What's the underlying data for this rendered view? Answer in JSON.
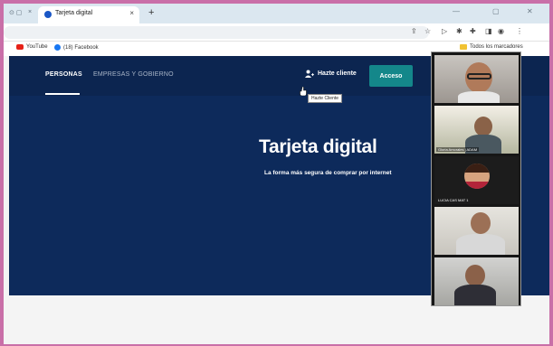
{
  "browser": {
    "tab_title": "Tarjeta digital",
    "tab_close": "×",
    "new_tab": "+",
    "bookmarks": [
      {
        "label": "YouTube"
      },
      {
        "label": "(18) Facebook"
      }
    ],
    "bookmarks_folder": "Todos los marcadores"
  },
  "nav": {
    "personas": "PERSONAS",
    "empresas": "EMPRESAS Y GOBIERNO",
    "hazte_cliente": "Hazte cliente",
    "acceso": "Acceso"
  },
  "hero": {
    "title": "Tarjeta digital",
    "subtitle": "La forma más segura de comprar por internet"
  },
  "tooltip": "Hazte Cliente",
  "video_call": {
    "participants": [
      {
        "label": ""
      },
      {
        "label": "Gloria Amorales | ADAM"
      },
      {
        "label": "LUCIA CAS MAT 1"
      },
      {
        "label": ""
      },
      {
        "label": ""
      }
    ]
  },
  "colors": {
    "nav_bg": "#0c2550",
    "hero_bg": "#0d2a5b",
    "accent_teal": "#14878a",
    "frame_border": "#c96fa8"
  }
}
